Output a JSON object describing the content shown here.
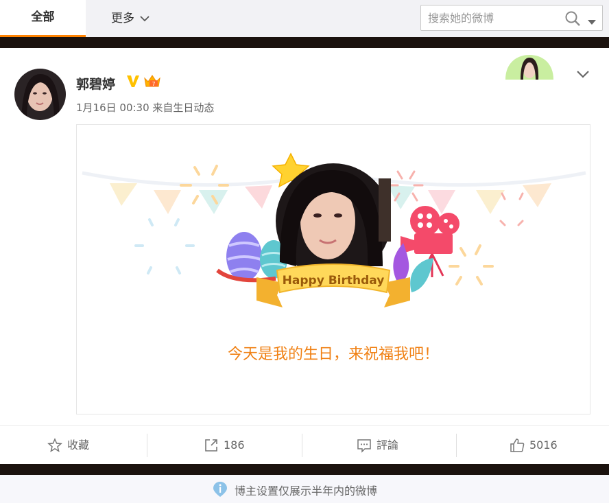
{
  "tabs": {
    "all_label": "全部",
    "more_label": "更多"
  },
  "search": {
    "placeholder": "搜索她的微博"
  },
  "post": {
    "username": "郭碧婷",
    "timestamp_source": "1月16日 00:30 来自生日动态",
    "birthday_banner_text": "Happy Birthday",
    "birthday_message": "今天是我的生日，来祝福我吧！"
  },
  "actions": {
    "favorite_label": "收藏",
    "repost_count": "186",
    "comment_label": "評論",
    "like_count": "5016"
  },
  "footer": {
    "notice": "博主设置仅展示半年内的微博"
  },
  "colors": {
    "accent": "#ff8200",
    "birthday_text": "#f08013",
    "dark_band": "#1b120e"
  }
}
